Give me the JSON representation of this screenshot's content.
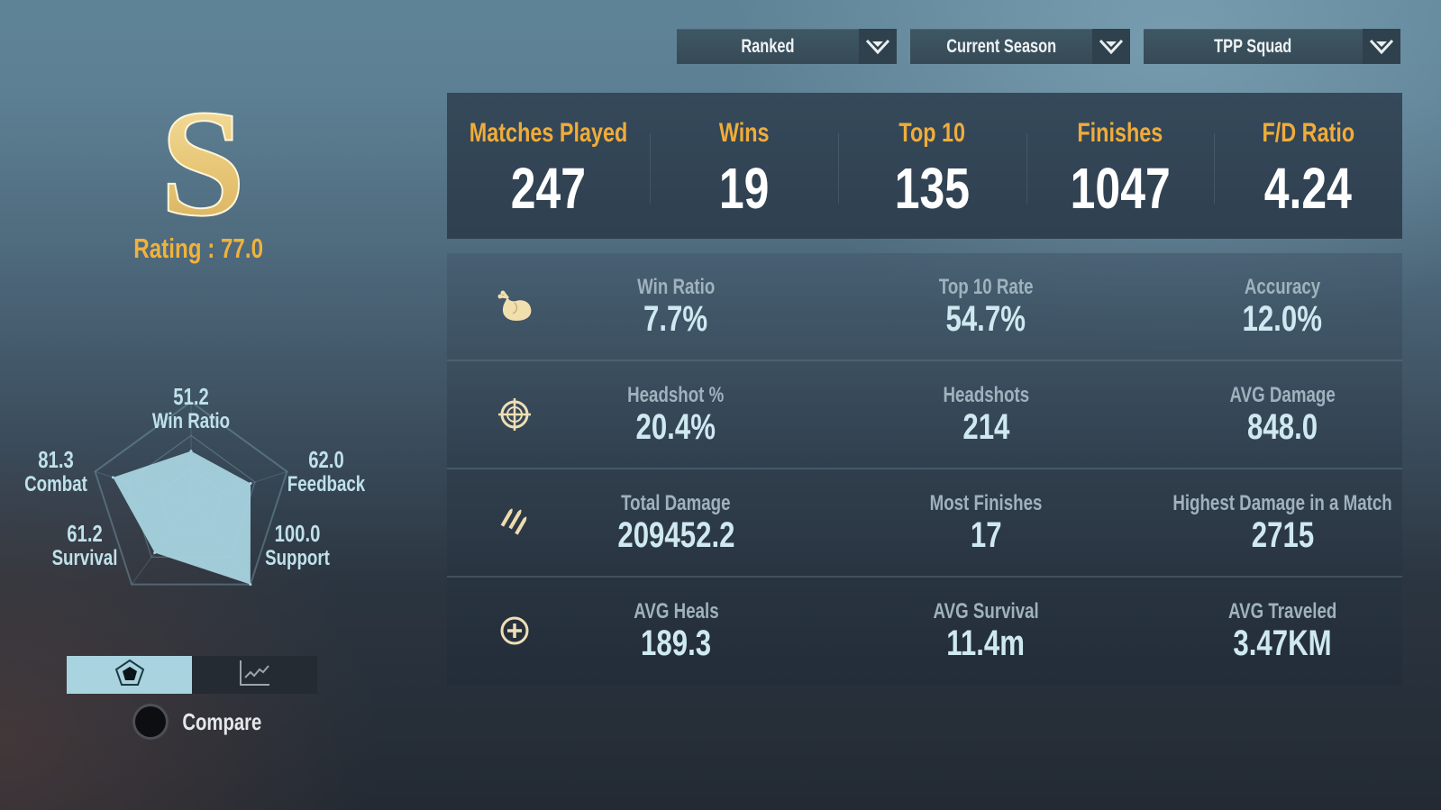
{
  "filters": [
    {
      "label": "Ranked",
      "icon": "chevron-down-icon"
    },
    {
      "label": "Current Season",
      "icon": "chevron-down-icon"
    },
    {
      "label": "TPP Squad",
      "icon": "chevron-down-icon"
    }
  ],
  "rank": {
    "tier_letter": "S",
    "rating_label": "Rating : 77.0"
  },
  "colors": {
    "accent_gold": "#f0b23c",
    "radar_fill": "#a8d3df",
    "value_text": "#cfe9f1",
    "label_text": "#9fb2bd"
  },
  "chart_data": {
    "type": "radar",
    "title": "",
    "axes": [
      "Win Ratio",
      "Feedback",
      "Support",
      "Survival",
      "Combat"
    ],
    "values": [
      51.2,
      62.0,
      100.0,
      61.2,
      81.3
    ],
    "value_labels": [
      "51.2",
      "62.0",
      "100.0",
      "61.2",
      "81.3"
    ],
    "range": [
      0,
      100
    ],
    "grid_levels": 3,
    "legend": "none"
  },
  "view_toggle": [
    {
      "name": "radar-view",
      "icon": "radar-chart-icon",
      "selected": true
    },
    {
      "name": "trend-view",
      "icon": "line-chart-icon",
      "selected": false
    }
  ],
  "compare": {
    "label": "Compare",
    "enabled": false
  },
  "summary": [
    {
      "label": "Matches Played",
      "value": "247"
    },
    {
      "label": "Wins",
      "value": "19"
    },
    {
      "label": "Top 10",
      "value": "135"
    },
    {
      "label": "Finishes",
      "value": "1047"
    },
    {
      "label": "F/D Ratio",
      "value": "4.24"
    }
  ],
  "details": [
    {
      "icon": "chicken-icon",
      "stats": [
        {
          "label": "Win Ratio",
          "value": "7.7%"
        },
        {
          "label": "Top 10 Rate",
          "value": "54.7%"
        },
        {
          "label": "Accuracy",
          "value": "12.0%"
        }
      ]
    },
    {
      "icon": "crosshair-icon",
      "stats": [
        {
          "label": "Headshot %",
          "value": "20.4%"
        },
        {
          "label": "Headshots",
          "value": "214"
        },
        {
          "label": "AVG Damage",
          "value": "848.0"
        }
      ]
    },
    {
      "icon": "bullets-icon",
      "stats": [
        {
          "label": "Total Damage",
          "value": "209452.2"
        },
        {
          "label": "Most Finishes",
          "value": "17"
        },
        {
          "label": "Highest Damage in a Match",
          "value": "2715"
        }
      ]
    },
    {
      "icon": "heal-plus-icon",
      "stats": [
        {
          "label": "AVG Heals",
          "value": "189.3"
        },
        {
          "label": "AVG Survival",
          "value": "11.4m"
        },
        {
          "label": "AVG Traveled",
          "value": "3.47KM"
        }
      ]
    }
  ]
}
